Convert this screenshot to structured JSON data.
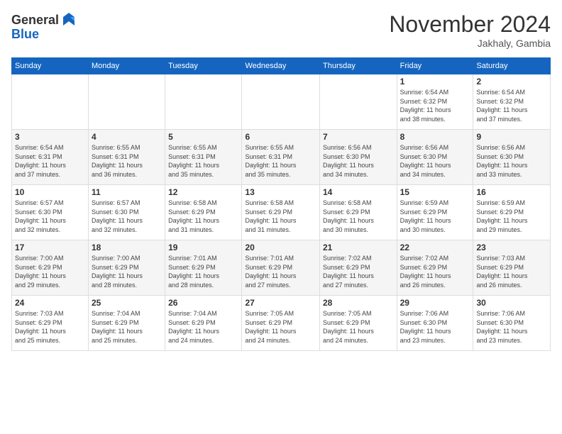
{
  "logo": {
    "general": "General",
    "blue": "Blue"
  },
  "title": "November 2024",
  "location": "Jakhaly, Gambia",
  "days_of_week": [
    "Sunday",
    "Monday",
    "Tuesday",
    "Wednesday",
    "Thursday",
    "Friday",
    "Saturday"
  ],
  "weeks": [
    [
      {
        "day": "",
        "info": ""
      },
      {
        "day": "",
        "info": ""
      },
      {
        "day": "",
        "info": ""
      },
      {
        "day": "",
        "info": ""
      },
      {
        "day": "",
        "info": ""
      },
      {
        "day": "1",
        "info": "Sunrise: 6:54 AM\nSunset: 6:32 PM\nDaylight: 11 hours\nand 38 minutes."
      },
      {
        "day": "2",
        "info": "Sunrise: 6:54 AM\nSunset: 6:32 PM\nDaylight: 11 hours\nand 37 minutes."
      }
    ],
    [
      {
        "day": "3",
        "info": "Sunrise: 6:54 AM\nSunset: 6:31 PM\nDaylight: 11 hours\nand 37 minutes."
      },
      {
        "day": "4",
        "info": "Sunrise: 6:55 AM\nSunset: 6:31 PM\nDaylight: 11 hours\nand 36 minutes."
      },
      {
        "day": "5",
        "info": "Sunrise: 6:55 AM\nSunset: 6:31 PM\nDaylight: 11 hours\nand 35 minutes."
      },
      {
        "day": "6",
        "info": "Sunrise: 6:55 AM\nSunset: 6:31 PM\nDaylight: 11 hours\nand 35 minutes."
      },
      {
        "day": "7",
        "info": "Sunrise: 6:56 AM\nSunset: 6:30 PM\nDaylight: 11 hours\nand 34 minutes."
      },
      {
        "day": "8",
        "info": "Sunrise: 6:56 AM\nSunset: 6:30 PM\nDaylight: 11 hours\nand 34 minutes."
      },
      {
        "day": "9",
        "info": "Sunrise: 6:56 AM\nSunset: 6:30 PM\nDaylight: 11 hours\nand 33 minutes."
      }
    ],
    [
      {
        "day": "10",
        "info": "Sunrise: 6:57 AM\nSunset: 6:30 PM\nDaylight: 11 hours\nand 32 minutes."
      },
      {
        "day": "11",
        "info": "Sunrise: 6:57 AM\nSunset: 6:30 PM\nDaylight: 11 hours\nand 32 minutes."
      },
      {
        "day": "12",
        "info": "Sunrise: 6:58 AM\nSunset: 6:29 PM\nDaylight: 11 hours\nand 31 minutes."
      },
      {
        "day": "13",
        "info": "Sunrise: 6:58 AM\nSunset: 6:29 PM\nDaylight: 11 hours\nand 31 minutes."
      },
      {
        "day": "14",
        "info": "Sunrise: 6:58 AM\nSunset: 6:29 PM\nDaylight: 11 hours\nand 30 minutes."
      },
      {
        "day": "15",
        "info": "Sunrise: 6:59 AM\nSunset: 6:29 PM\nDaylight: 11 hours\nand 30 minutes."
      },
      {
        "day": "16",
        "info": "Sunrise: 6:59 AM\nSunset: 6:29 PM\nDaylight: 11 hours\nand 29 minutes."
      }
    ],
    [
      {
        "day": "17",
        "info": "Sunrise: 7:00 AM\nSunset: 6:29 PM\nDaylight: 11 hours\nand 29 minutes."
      },
      {
        "day": "18",
        "info": "Sunrise: 7:00 AM\nSunset: 6:29 PM\nDaylight: 11 hours\nand 28 minutes."
      },
      {
        "day": "19",
        "info": "Sunrise: 7:01 AM\nSunset: 6:29 PM\nDaylight: 11 hours\nand 28 minutes."
      },
      {
        "day": "20",
        "info": "Sunrise: 7:01 AM\nSunset: 6:29 PM\nDaylight: 11 hours\nand 27 minutes."
      },
      {
        "day": "21",
        "info": "Sunrise: 7:02 AM\nSunset: 6:29 PM\nDaylight: 11 hours\nand 27 minutes."
      },
      {
        "day": "22",
        "info": "Sunrise: 7:02 AM\nSunset: 6:29 PM\nDaylight: 11 hours\nand 26 minutes."
      },
      {
        "day": "23",
        "info": "Sunrise: 7:03 AM\nSunset: 6:29 PM\nDaylight: 11 hours\nand 26 minutes."
      }
    ],
    [
      {
        "day": "24",
        "info": "Sunrise: 7:03 AM\nSunset: 6:29 PM\nDaylight: 11 hours\nand 25 minutes."
      },
      {
        "day": "25",
        "info": "Sunrise: 7:04 AM\nSunset: 6:29 PM\nDaylight: 11 hours\nand 25 minutes."
      },
      {
        "day": "26",
        "info": "Sunrise: 7:04 AM\nSunset: 6:29 PM\nDaylight: 11 hours\nand 24 minutes."
      },
      {
        "day": "27",
        "info": "Sunrise: 7:05 AM\nSunset: 6:29 PM\nDaylight: 11 hours\nand 24 minutes."
      },
      {
        "day": "28",
        "info": "Sunrise: 7:05 AM\nSunset: 6:29 PM\nDaylight: 11 hours\nand 24 minutes."
      },
      {
        "day": "29",
        "info": "Sunrise: 7:06 AM\nSunset: 6:30 PM\nDaylight: 11 hours\nand 23 minutes."
      },
      {
        "day": "30",
        "info": "Sunrise: 7:06 AM\nSunset: 6:30 PM\nDaylight: 11 hours\nand 23 minutes."
      }
    ]
  ]
}
